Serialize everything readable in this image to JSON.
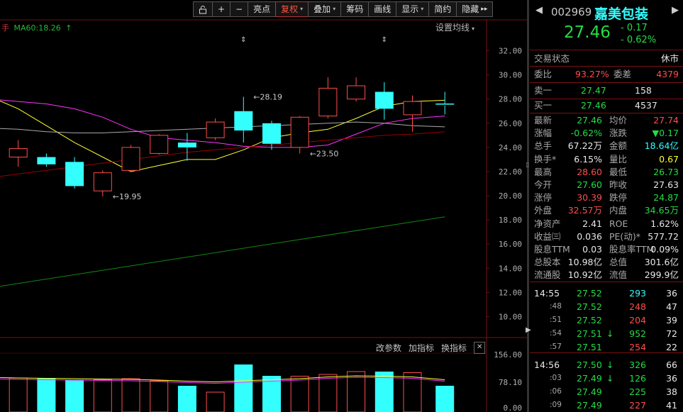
{
  "colors": {
    "up": "#ff4d4d",
    "down": "#22dd44",
    "accent_cyan": "#33ffff",
    "yellow": "#ffff33",
    "grid": "#7a1010"
  },
  "toolbar": {
    "items": [
      {
        "name": "lock-icon",
        "label": "",
        "icon": "lock"
      },
      {
        "name": "zoom-in-button",
        "label": "+"
      },
      {
        "name": "zoom-out-button",
        "label": "−"
      },
      {
        "name": "highlight-button",
        "label": "亮点"
      },
      {
        "name": "adjust-button",
        "label": "复权",
        "caret": true,
        "active": true
      },
      {
        "name": "overlay-button",
        "label": "叠加",
        "caret": true
      },
      {
        "name": "chips-button",
        "label": "筹码"
      },
      {
        "name": "draw-line-button",
        "label": "画线"
      },
      {
        "name": "display-button",
        "label": "显示",
        "caret": true
      },
      {
        "name": "simple-button",
        "label": "简约"
      },
      {
        "name": "hide-button",
        "label": "隐藏",
        "arrow": "▸▸"
      }
    ]
  },
  "ma_legend": {
    "ma60": "MA60:18.26",
    "arrow": "↑"
  },
  "ma_settings": "设置均线",
  "volume_panel": {
    "params": "改参数",
    "add": "加指标",
    "switch": "换指标",
    "close": "✕"
  },
  "chart_data": [
    {
      "type": "candlestick",
      "ylim": [
        8.5,
        33.5
      ],
      "y_ticks": [
        "32.00",
        "30.00",
        "28.00",
        "26.00",
        "24.00",
        "22.00",
        "20.00",
        "18.00",
        "16.00",
        "14.00",
        "12.00",
        "10.00"
      ],
      "candles": [
        {
          "o": 25.2,
          "c": 23.6,
          "h": 25.6,
          "l": 23.4
        },
        {
          "o": 23.2,
          "c": 23.9,
          "h": 24.6,
          "l": 22.4
        },
        {
          "o": 23.2,
          "c": 22.6,
          "h": 23.5,
          "l": 22.4
        },
        {
          "o": 22.8,
          "c": 20.8,
          "h": 23.2,
          "l": 20.6
        },
        {
          "o": 20.4,
          "c": 21.9,
          "h": 22.1,
          "l": 19.95
        },
        {
          "o": 22.1,
          "c": 24.0,
          "h": 24.2,
          "l": 22.0
        },
        {
          "o": 23.5,
          "c": 25.0,
          "h": 25.1,
          "l": 23.4
        },
        {
          "o": 24.4,
          "c": 24.0,
          "h": 25.2,
          "l": 22.9
        },
        {
          "o": 24.8,
          "c": 26.1,
          "h": 26.4,
          "l": 24.6
        },
        {
          "o": 27.0,
          "c": 25.4,
          "h": 28.19,
          "l": 24.4
        },
        {
          "o": 26.0,
          "c": 24.3,
          "h": 26.2,
          "l": 23.8
        },
        {
          "o": 24.0,
          "c": 26.5,
          "h": 26.6,
          "l": 23.5
        },
        {
          "o": 26.6,
          "c": 28.9,
          "h": 29.8,
          "l": 26.4
        },
        {
          "o": 28.0,
          "c": 29.1,
          "h": 29.8,
          "l": 27.8
        },
        {
          "o": 28.6,
          "c": 27.2,
          "h": 29.4,
          "l": 26.3
        },
        {
          "o": 26.7,
          "c": 27.8,
          "h": 28.3,
          "l": 25.3
        },
        {
          "o": 27.63,
          "c": 27.46,
          "h": 28.6,
          "l": 26.73
        }
      ],
      "ma_lines": [
        {
          "name": "MA5",
          "color": "#ffff33",
          "values": [
            28.2,
            27.2,
            25.8,
            24.4,
            23.2,
            22.0,
            22.5,
            23.0,
            23.0,
            23.8,
            24.8,
            25.2,
            25.5,
            26.4,
            27.4,
            27.8,
            27.9
          ]
        },
        {
          "name": "MA10",
          "color": "#ff33ff",
          "values": [
            28.0,
            27.8,
            27.6,
            27.2,
            26.5,
            25.5,
            24.8,
            24.6,
            24.4,
            24.1,
            24.0,
            24.0,
            24.2,
            25.1,
            26.0,
            26.4,
            26.6
          ]
        },
        {
          "name": "MA20",
          "color": "#aaaaaa",
          "values": [
            25.6,
            25.5,
            25.3,
            25.2,
            25.2,
            25.3,
            25.4,
            25.5,
            25.6,
            25.7,
            25.8,
            25.9,
            26.0,
            26.1,
            26.0,
            25.8,
            25.7
          ]
        },
        {
          "name": "MA30",
          "color": "#990000",
          "values": [
            21.5,
            21.8,
            22.1,
            22.4,
            22.7,
            23.0,
            23.3,
            23.6,
            23.8,
            24.0,
            24.2,
            24.4,
            24.6,
            24.8,
            25.0,
            25.1,
            25.3
          ]
        },
        {
          "name": "MA60",
          "color": "#118811",
          "values": [
            12.5,
            12.9,
            13.3,
            13.7,
            14.0,
            14.4,
            14.8,
            15.1,
            15.4,
            15.7,
            16.0,
            16.3,
            16.6,
            16.9,
            17.3,
            17.6,
            18.26
          ]
        }
      ],
      "annotations": [
        {
          "candle": 4,
          "value": 19.95,
          "label": "←19.95",
          "at": "low"
        },
        {
          "candle": 9,
          "value": 28.19,
          "label": "←28.19",
          "at": "high"
        },
        {
          "candle": 11,
          "value": 23.5,
          "label": "←23.50",
          "at": "low"
        }
      ],
      "markers": [
        9,
        14
      ]
    },
    {
      "type": "bar",
      "ylim": [
        0,
        156
      ],
      "y_ticks": [
        "156.00",
        "78.10",
        "0.00"
      ],
      "values": [
        95,
        90,
        90,
        85,
        85,
        88,
        82,
        68,
        50,
        128,
        96,
        95,
        100,
        108,
        108,
        105,
        68
      ],
      "ma_line": [
        92,
        90,
        89,
        88,
        87,
        86,
        84,
        81,
        79,
        82,
        85,
        88,
        93,
        96,
        95,
        93,
        85
      ],
      "colors_up": [
        false,
        true,
        false,
        false,
        true,
        true,
        true,
        false,
        true,
        false,
        false,
        true,
        true,
        true,
        false,
        true,
        false
      ]
    }
  ],
  "quote": {
    "code": "002969",
    "name": "嘉美包装",
    "price": "27.46",
    "change": "- 0.17",
    "pct": "- 0.62%",
    "trade_status_label": "交易状态",
    "trade_status": "休市",
    "weibi_label": "委比",
    "weibi": "93.27%",
    "weicha_label": "委差",
    "weicha": "4379",
    "sell1_label": "卖一",
    "sell1_price": "27.47",
    "sell1_vol": "158",
    "buy1_label": "买一",
    "buy1_price": "27.46",
    "buy1_vol": "4537",
    "stats": [
      {
        "l1": "最新",
        "v1": "27.46",
        "c1": "green",
        "l2": "均价",
        "v2": "27.74",
        "c2": "red"
      },
      {
        "l1": "涨幅",
        "v1": "-0.62%",
        "c1": "green",
        "l2": "涨跌",
        "v2": "▼0.17",
        "c2": "green"
      },
      {
        "l1": "总手",
        "v1": "67.22万",
        "c1": "white",
        "l2": "金额",
        "v2": "18.64亿",
        "c2": "cyan"
      },
      {
        "l1": "换手*",
        "v1": "6.15%",
        "c1": "white",
        "l2": "量比",
        "v2": "0.67",
        "c2": "yellow"
      },
      {
        "l1": "最高",
        "v1": "28.60",
        "c1": "red",
        "l2": "最低",
        "v2": "26.73",
        "c2": "green"
      },
      {
        "l1": "今开",
        "v1": "27.60",
        "c1": "green",
        "l2": "昨收",
        "v2": "27.63",
        "c2": "white"
      },
      {
        "l1": "涨停",
        "v1": "30.39",
        "c1": "red",
        "l2": "跌停",
        "v2": "24.87",
        "c2": "green"
      },
      {
        "l1": "外盘",
        "v1": "32.57万",
        "c1": "red",
        "l2": "内盘",
        "v2": "34.65万",
        "c2": "green"
      },
      {
        "l1": "净资产",
        "v1": "2.41",
        "c1": "white",
        "l2": "ROE",
        "v2": "1.62%",
        "c2": "white"
      },
      {
        "l1": "收益㈢",
        "v1": "0.036",
        "c1": "white",
        "l2": "PE(动)*",
        "v2": "577.72",
        "c2": "white"
      },
      {
        "l1": "股息TTM",
        "v1": "0.03",
        "c1": "white",
        "l2": "股息率TTM",
        "v2": "0.09%",
        "c2": "white"
      },
      {
        "l1": "总股本",
        "v1": "10.98亿",
        "c1": "white",
        "l2": "总值",
        "v2": "301.6亿",
        "c2": "white"
      },
      {
        "l1": "流通股",
        "v1": "10.92亿",
        "c1": "white",
        "l2": "流值",
        "v2": "299.9亿",
        "c2": "white"
      }
    ],
    "ticks": [
      {
        "t": "14:55",
        "p": "27.52",
        "arrow": "",
        "v": "293",
        "vc": "cyan",
        "n": "36"
      },
      {
        "t": ":48",
        "p": "27.52",
        "arrow": "",
        "v": "248",
        "vc": "red",
        "n": "47"
      },
      {
        "t": ":51",
        "p": "27.52",
        "arrow": "",
        "v": "204",
        "vc": "red",
        "n": "39"
      },
      {
        "t": ":54",
        "p": "27.51",
        "arrow": "↓",
        "v": "952",
        "vc": "green",
        "n": "72"
      },
      {
        "t": ":57",
        "p": "27.51",
        "arrow": "",
        "v": "254",
        "vc": "red",
        "n": "22"
      },
      {
        "t": "14:56",
        "p": "27.50",
        "arrow": "↓",
        "v": "326",
        "vc": "green",
        "n": "66"
      },
      {
        "t": ":03",
        "p": "27.49",
        "arrow": "↓",
        "v": "126",
        "vc": "green",
        "n": "36"
      },
      {
        "t": ":06",
        "p": "27.49",
        "arrow": "",
        "v": "225",
        "vc": "green",
        "n": "38"
      },
      {
        "t": ":09",
        "p": "27.49",
        "arrow": "",
        "v": "227",
        "vc": "red",
        "n": "41"
      }
    ]
  }
}
